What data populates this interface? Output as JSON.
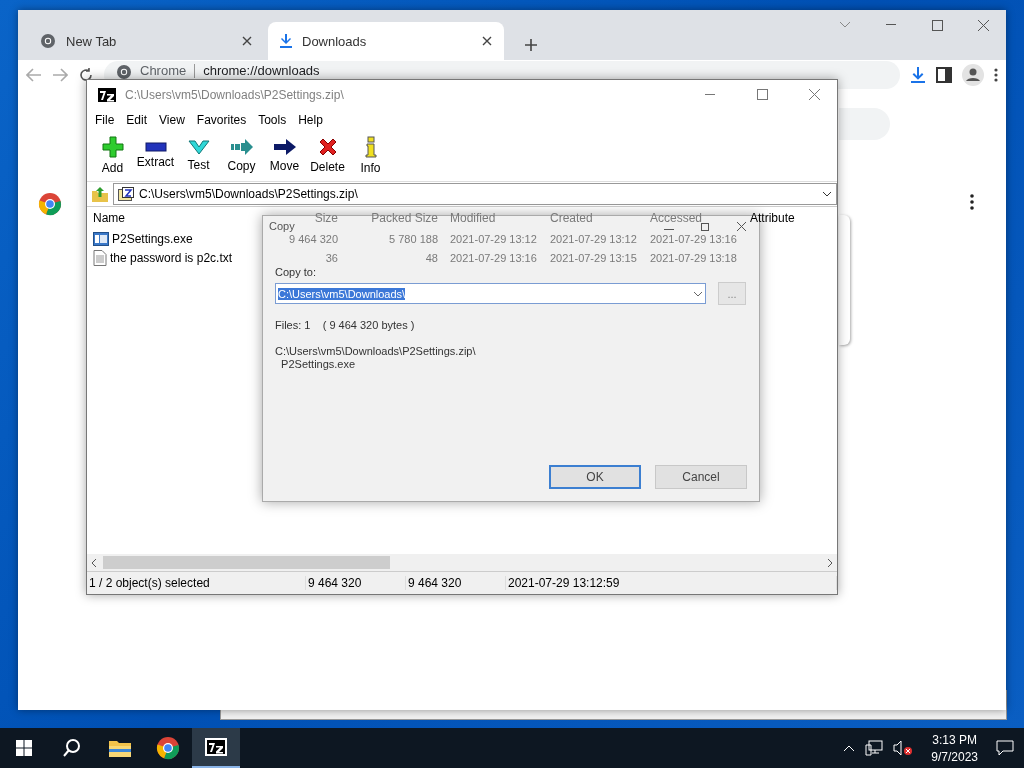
{
  "browser": {
    "tabs": [
      {
        "label": "New Tab",
        "selected": false
      },
      {
        "label": "Downloads",
        "selected": true
      }
    ],
    "omnibox": {
      "site": "Chrome",
      "url": "chrome://downloads"
    }
  },
  "archive_window": {
    "title": "C:\\Users\\vm5\\Downloads\\P2Settings.zip\\",
    "menu": [
      "File",
      "Edit",
      "View",
      "Favorites",
      "Tools",
      "Help"
    ],
    "toolbar": [
      {
        "label": "Add",
        "kind": "add"
      },
      {
        "label": "Extract",
        "kind": "extract"
      },
      {
        "label": "Test",
        "kind": "test"
      },
      {
        "label": "Copy",
        "kind": "copy"
      },
      {
        "label": "Move",
        "kind": "move"
      },
      {
        "label": "Delete",
        "kind": "delete"
      },
      {
        "label": "Info",
        "kind": "info"
      }
    ],
    "address": "C:\\Users\\vm5\\Downloads\\P2Settings.zip\\",
    "columns": [
      "Name",
      "Size",
      "Packed Size",
      "Modified",
      "Created",
      "Accessed",
      "Attribute"
    ],
    "rows": [
      {
        "kind": "exe",
        "cells": [
          "P2Settings.exe",
          "9 464 320",
          "5 780 188",
          "2021-07-29 13:12",
          "2021-07-29 13:12",
          "2021-07-29 13:16"
        ]
      },
      {
        "kind": "text",
        "cells": [
          "the password is p2c.txt",
          "36",
          "48",
          "2021-07-29 13:16",
          "2021-07-29 13:15",
          "2021-07-29 13:18"
        ]
      }
    ],
    "status_bar": [
      "1 / 2 object(s) selected",
      "9 464 320",
      "9 464 320",
      "2021-07-29 13:12:59"
    ]
  },
  "dialog": {
    "title": "Copy",
    "copy_to_label": "Copy to:",
    "destination": "C:\\Users\\vm5\\Downloads\\",
    "browse_button": "...",
    "files_info": "Files: 1    ( 9 464 320 bytes )",
    "source_lines": [
      "C:\\Users\\vm5\\Downloads\\P2Settings.zip\\",
      "  P2Settings.exe"
    ],
    "buttons": [
      {
        "label": "OK",
        "kind": "default"
      },
      {
        "label": "Cancel",
        "kind": "normal"
      }
    ]
  },
  "taskbar": {
    "apps": [
      {
        "kind": "explorer",
        "active": false
      },
      {
        "kind": "chrome",
        "active": false
      },
      {
        "kind": "sevenzip",
        "active": true
      }
    ],
    "time": "3:13 PM",
    "date": "9/7/2023"
  }
}
